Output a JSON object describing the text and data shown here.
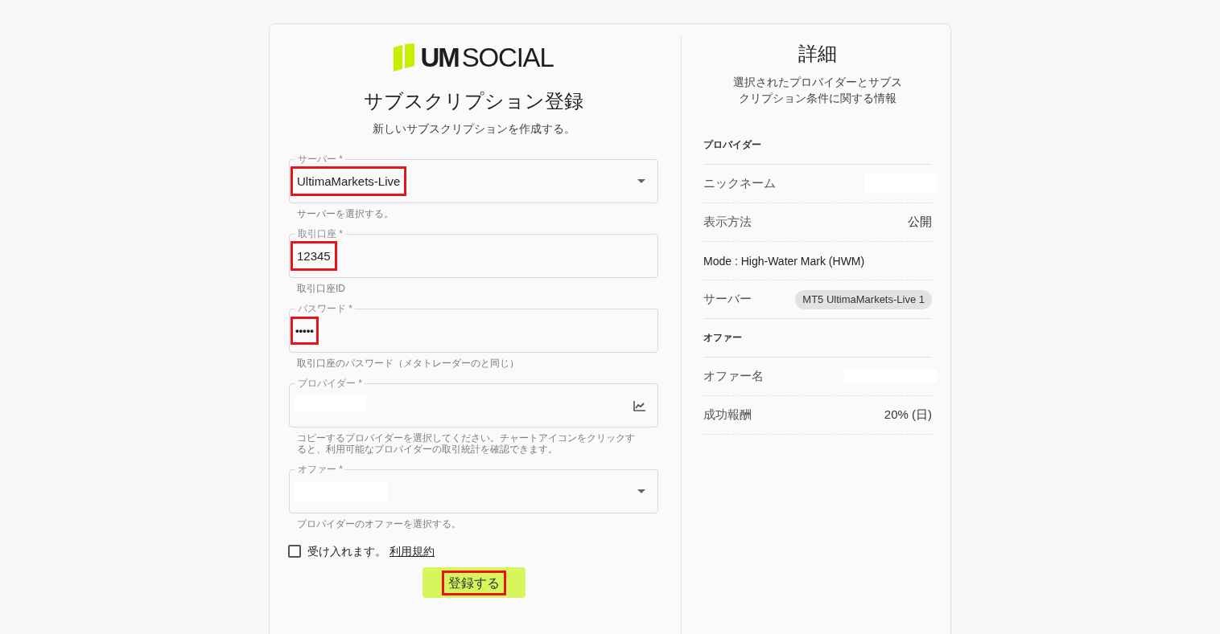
{
  "logo": {
    "text": "**UM**SOCIAL"
  },
  "form": {
    "title": "サブスクリプション登録",
    "subtitle": "新しいサブスクリプションを作成する。",
    "fields": [
      {
        "kind": "select",
        "label": "サーバー *",
        "value": "UltimaMarkets-Live",
        "redacted": false,
        "highlighted": true,
        "helper": "サーバーを選択する。"
      },
      {
        "kind": "text",
        "label": "取引口座 *",
        "value": "12345",
        "redacted": false,
        "highlighted": true,
        "helper": "取引口座ID"
      },
      {
        "kind": "password",
        "label": "パスワード *",
        "value": "•••••",
        "redacted": false,
        "highlighted": true,
        "helper": "取引口座のパスワード（メタトレーダーのと同じ）"
      },
      {
        "kind": "chart",
        "label": "プロバイダー *",
        "redacted": true,
        "highlighted": false,
        "helper": "コピーするプロバイダーを選択してください。チャートアイコンをクリックすると、利用可能なプロバイダーの取引統計を確認できます。"
      },
      {
        "kind": "select",
        "label": "オファー *",
        "redacted": true,
        "highlighted": false,
        "helper": "プロバイダーのオファーを選択する。"
      }
    ],
    "terms": {
      "checked": false,
      "text": "受け入れます。",
      "link": "利用規約"
    },
    "submit": {
      "label": "登録する",
      "highlighted": true
    }
  },
  "details": {
    "title": "詳細",
    "description": "選択されたプロバイダーとサブスクリプション条件に関する情報",
    "sections": [
      {
        "heading": "プロバイダー",
        "rows": [
          {
            "kind": "pair",
            "label": "ニックネーム",
            "redacted": true
          },
          {
            "kind": "pair",
            "label": "表示方法",
            "value": "公開",
            "redacted": false
          },
          {
            "kind": "line",
            "label": "Mode : High-Water Mark (HWM)"
          },
          {
            "kind": "chip",
            "label": "サーバー",
            "value": "MT5 UltimaMarkets-Live 1"
          }
        ]
      },
      {
        "heading": "オファー",
        "rows": [
          {
            "kind": "pair",
            "label": "オファー名",
            "redacted": true
          },
          {
            "kind": "pair",
            "label": "成功報酬",
            "value": "20% (日)",
            "redacted": false
          }
        ]
      }
    ]
  }
}
